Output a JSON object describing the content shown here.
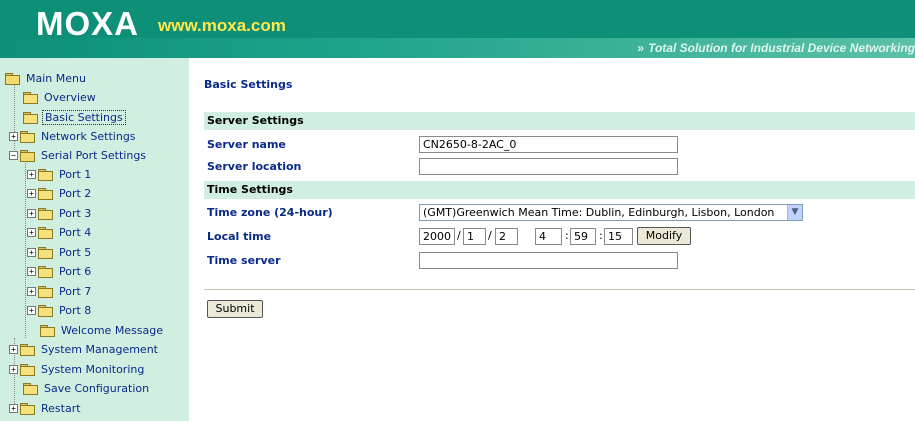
{
  "header": {
    "logo": "MOXA",
    "url": "www.moxa.com",
    "tagline": "Total Solution for Industrial Device Networking"
  },
  "sidebar": {
    "items": [
      {
        "label": "Main Menu"
      },
      {
        "label": "Overview"
      },
      {
        "label": "Basic Settings"
      },
      {
        "label": "Network Settings"
      },
      {
        "label": "Serial Port Settings"
      },
      {
        "label": "Port 1"
      },
      {
        "label": "Port 2"
      },
      {
        "label": "Port 3"
      },
      {
        "label": "Port 4"
      },
      {
        "label": "Port 5"
      },
      {
        "label": "Port 6"
      },
      {
        "label": "Port 7"
      },
      {
        "label": "Port 8"
      },
      {
        "label": "Welcome Message"
      },
      {
        "label": "System Management"
      },
      {
        "label": "System Monitoring"
      },
      {
        "label": "Save Configuration"
      },
      {
        "label": "Restart"
      }
    ]
  },
  "main": {
    "title": "Basic Settings",
    "server_section": "Server Settings",
    "server_name_label": "Server name",
    "server_name_value": "CN2650-8-2AC_0",
    "server_location_label": "Server location",
    "server_location_value": "",
    "time_section": "Time Settings",
    "timezone_label": "Time zone (24-hour)",
    "timezone_value": "(GMT)Greenwich Mean Time: Dublin, Edinburgh, Lisbon, London",
    "local_time_label": "Local time",
    "local_time": {
      "year": "2000",
      "month": "1",
      "day": "2",
      "hour": "4",
      "minute": "59",
      "second": "15"
    },
    "modify_label": "Modify",
    "time_server_label": "Time server",
    "time_server_value": "",
    "submit_label": "Submit"
  }
}
